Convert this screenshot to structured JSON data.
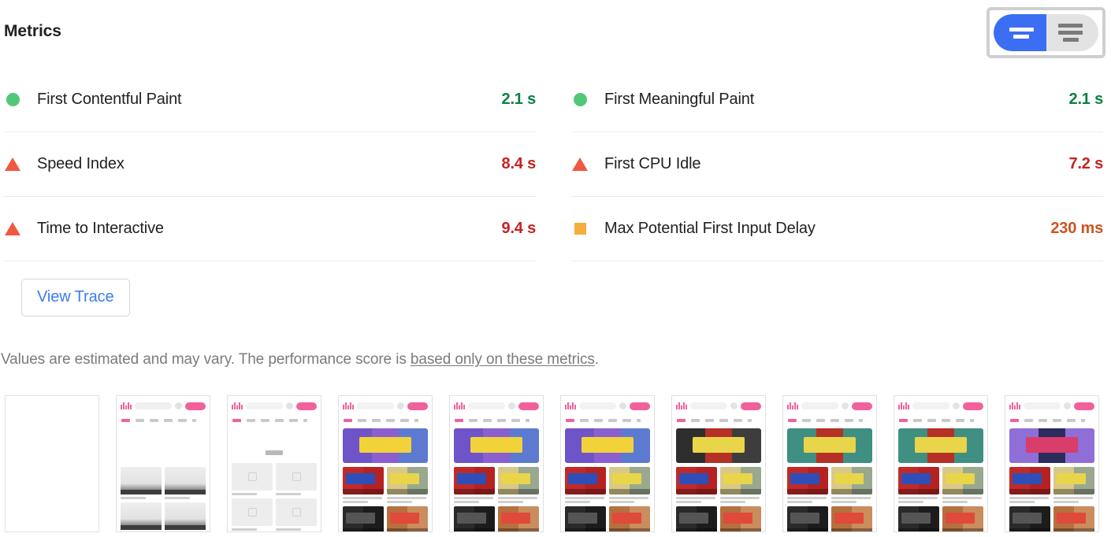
{
  "header": {
    "title": "Metrics",
    "toggle": {
      "name": "metrics-view-toggle",
      "options": [
        "simple-view",
        "detail-view"
      ],
      "selected": "simple-view",
      "active_color": "#3b6ef3",
      "inactive_color": "#e3e3e3"
    }
  },
  "metrics": {
    "left_column": [
      {
        "label": "First Contentful Paint",
        "value": "2.1 s",
        "rating": "pass",
        "icon": "circle-pass-icon",
        "color": "#0c8040"
      },
      {
        "label": "Speed Index",
        "value": "8.4 s",
        "rating": "fail",
        "icon": "triangle-fail-icon",
        "color": "#c7221f"
      },
      {
        "label": "Time to Interactive",
        "value": "9.4 s",
        "rating": "fail",
        "icon": "triangle-fail-icon",
        "color": "#c7221f"
      }
    ],
    "right_column": [
      {
        "label": "First Meaningful Paint",
        "value": "2.1 s",
        "rating": "pass",
        "icon": "circle-pass-icon",
        "color": "#0c8040"
      },
      {
        "label": "First CPU Idle",
        "value": "7.2 s",
        "rating": "fail",
        "icon": "triangle-fail-icon",
        "color": "#c7221f"
      },
      {
        "label": "Max Potential First Input Delay",
        "value": "230 ms",
        "rating": "average",
        "icon": "square-average-icon",
        "color": "#cd5320"
      }
    ]
  },
  "actions": {
    "view_trace_label": "View Trace"
  },
  "disclaimer": {
    "text_before": "Values are estimated and may vary. The performance score is ",
    "link_text": "based only on these metrics",
    "text_after": "."
  },
  "filmstrip": {
    "name": "screenshot-filmstrip",
    "frame_count": 10,
    "frames": [
      {
        "state": "blank"
      },
      {
        "state": "skeleton-plain"
      },
      {
        "state": "skeleton-icons"
      },
      {
        "state": "loaded",
        "banner": "purple"
      },
      {
        "state": "loaded",
        "banner": "purple"
      },
      {
        "state": "loaded",
        "banner": "purple"
      },
      {
        "state": "loaded",
        "banner": "red"
      },
      {
        "state": "loaded",
        "banner": "teal"
      },
      {
        "state": "loaded",
        "banner": "teal"
      },
      {
        "state": "loaded",
        "banner": "dark"
      }
    ]
  }
}
